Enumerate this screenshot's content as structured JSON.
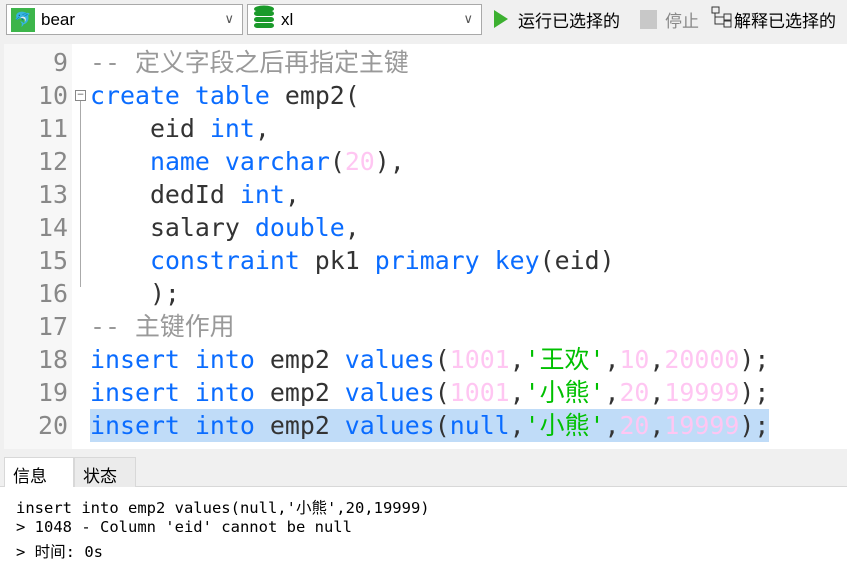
{
  "toolbar": {
    "connection": "bear",
    "connection_icon": "mysql-dolphin-icon",
    "database": "xl",
    "database_icon": "database-icon",
    "run_selected": "运行已选择的",
    "stop": "停止",
    "explain_selected": "解释已选择的"
  },
  "colors": {
    "keyword": "#0a6cff",
    "number": "#ffc6f2",
    "string": "#00c000",
    "comment": "#999999",
    "highlight": "#c0dcf8"
  },
  "editor": {
    "highlighted_line": "20",
    "lines": [
      {
        "n": "9",
        "tokens": [
          [
            "cm",
            "-- 定义字段之后再指定主键"
          ]
        ]
      },
      {
        "n": "10",
        "tokens": [
          [
            "kw",
            "create"
          ],
          [
            "id",
            " "
          ],
          [
            "kw",
            "table"
          ],
          [
            "id",
            " emp2("
          ]
        ]
      },
      {
        "n": "11",
        "tokens": [
          [
            "id",
            "    eid "
          ],
          [
            "kw",
            "int"
          ],
          [
            "id",
            ","
          ]
        ]
      },
      {
        "n": "12",
        "tokens": [
          [
            "id",
            "    "
          ],
          [
            "kw",
            "name"
          ],
          [
            "id",
            " "
          ],
          [
            "kw",
            "varchar"
          ],
          [
            "id",
            "("
          ],
          [
            "num",
            "20"
          ],
          [
            "id",
            "),"
          ]
        ]
      },
      {
        "n": "13",
        "tokens": [
          [
            "id",
            "    dedId "
          ],
          [
            "kw",
            "int"
          ],
          [
            "id",
            ","
          ]
        ]
      },
      {
        "n": "14",
        "tokens": [
          [
            "id",
            "    salary "
          ],
          [
            "kw",
            "double"
          ],
          [
            "id",
            ","
          ]
        ]
      },
      {
        "n": "15",
        "tokens": [
          [
            "id",
            "    "
          ],
          [
            "kw",
            "constraint"
          ],
          [
            "id",
            " pk1 "
          ],
          [
            "kw",
            "primary"
          ],
          [
            "id",
            " "
          ],
          [
            "kw",
            "key"
          ],
          [
            "id",
            "(eid)"
          ]
        ]
      },
      {
        "n": "16",
        "tokens": [
          [
            "id",
            "    );"
          ]
        ]
      },
      {
        "n": "17",
        "tokens": [
          [
            "cm",
            "-- 主键作用"
          ]
        ]
      },
      {
        "n": "18",
        "tokens": [
          [
            "kw",
            "insert"
          ],
          [
            "id",
            " "
          ],
          [
            "kw",
            "into"
          ],
          [
            "id",
            " emp2 "
          ],
          [
            "kw",
            "values"
          ],
          [
            "id",
            "("
          ],
          [
            "num",
            "1001"
          ],
          [
            "id",
            ","
          ],
          [
            "str",
            "'王欢'"
          ],
          [
            "id",
            ","
          ],
          [
            "num",
            "10"
          ],
          [
            "id",
            ","
          ],
          [
            "num",
            "20000"
          ],
          [
            "id",
            ");"
          ]
        ]
      },
      {
        "n": "19",
        "tokens": [
          [
            "kw",
            "insert"
          ],
          [
            "id",
            " "
          ],
          [
            "kw",
            "into"
          ],
          [
            "id",
            " emp2 "
          ],
          [
            "kw",
            "values"
          ],
          [
            "id",
            "("
          ],
          [
            "num",
            "1001"
          ],
          [
            "id",
            ","
          ],
          [
            "str",
            "'小熊'"
          ],
          [
            "id",
            ","
          ],
          [
            "num",
            "20"
          ],
          [
            "id",
            ","
          ],
          [
            "num",
            "19999"
          ],
          [
            "id",
            ");"
          ]
        ]
      },
      {
        "n": "20",
        "tokens": [
          [
            "kw",
            "insert"
          ],
          [
            "id",
            " "
          ],
          [
            "kw",
            "into"
          ],
          [
            "id",
            " emp2 "
          ],
          [
            "kw",
            "values"
          ],
          [
            "id",
            "("
          ],
          [
            "kw",
            "null"
          ],
          [
            "id",
            ","
          ],
          [
            "str",
            "'小熊'"
          ],
          [
            "id",
            ","
          ],
          [
            "num",
            "20"
          ],
          [
            "id",
            ","
          ],
          [
            "num",
            "19999"
          ],
          [
            "id",
            ");"
          ]
        ]
      }
    ]
  },
  "panel": {
    "tabs": [
      {
        "label": "信息",
        "active": true
      },
      {
        "label": "状态",
        "active": false
      }
    ],
    "messages": [
      "insert into emp2 values(null,'小熊',20,19999)",
      "> 1048 - Column 'eid' cannot be null",
      "> 时间: 0s"
    ]
  }
}
